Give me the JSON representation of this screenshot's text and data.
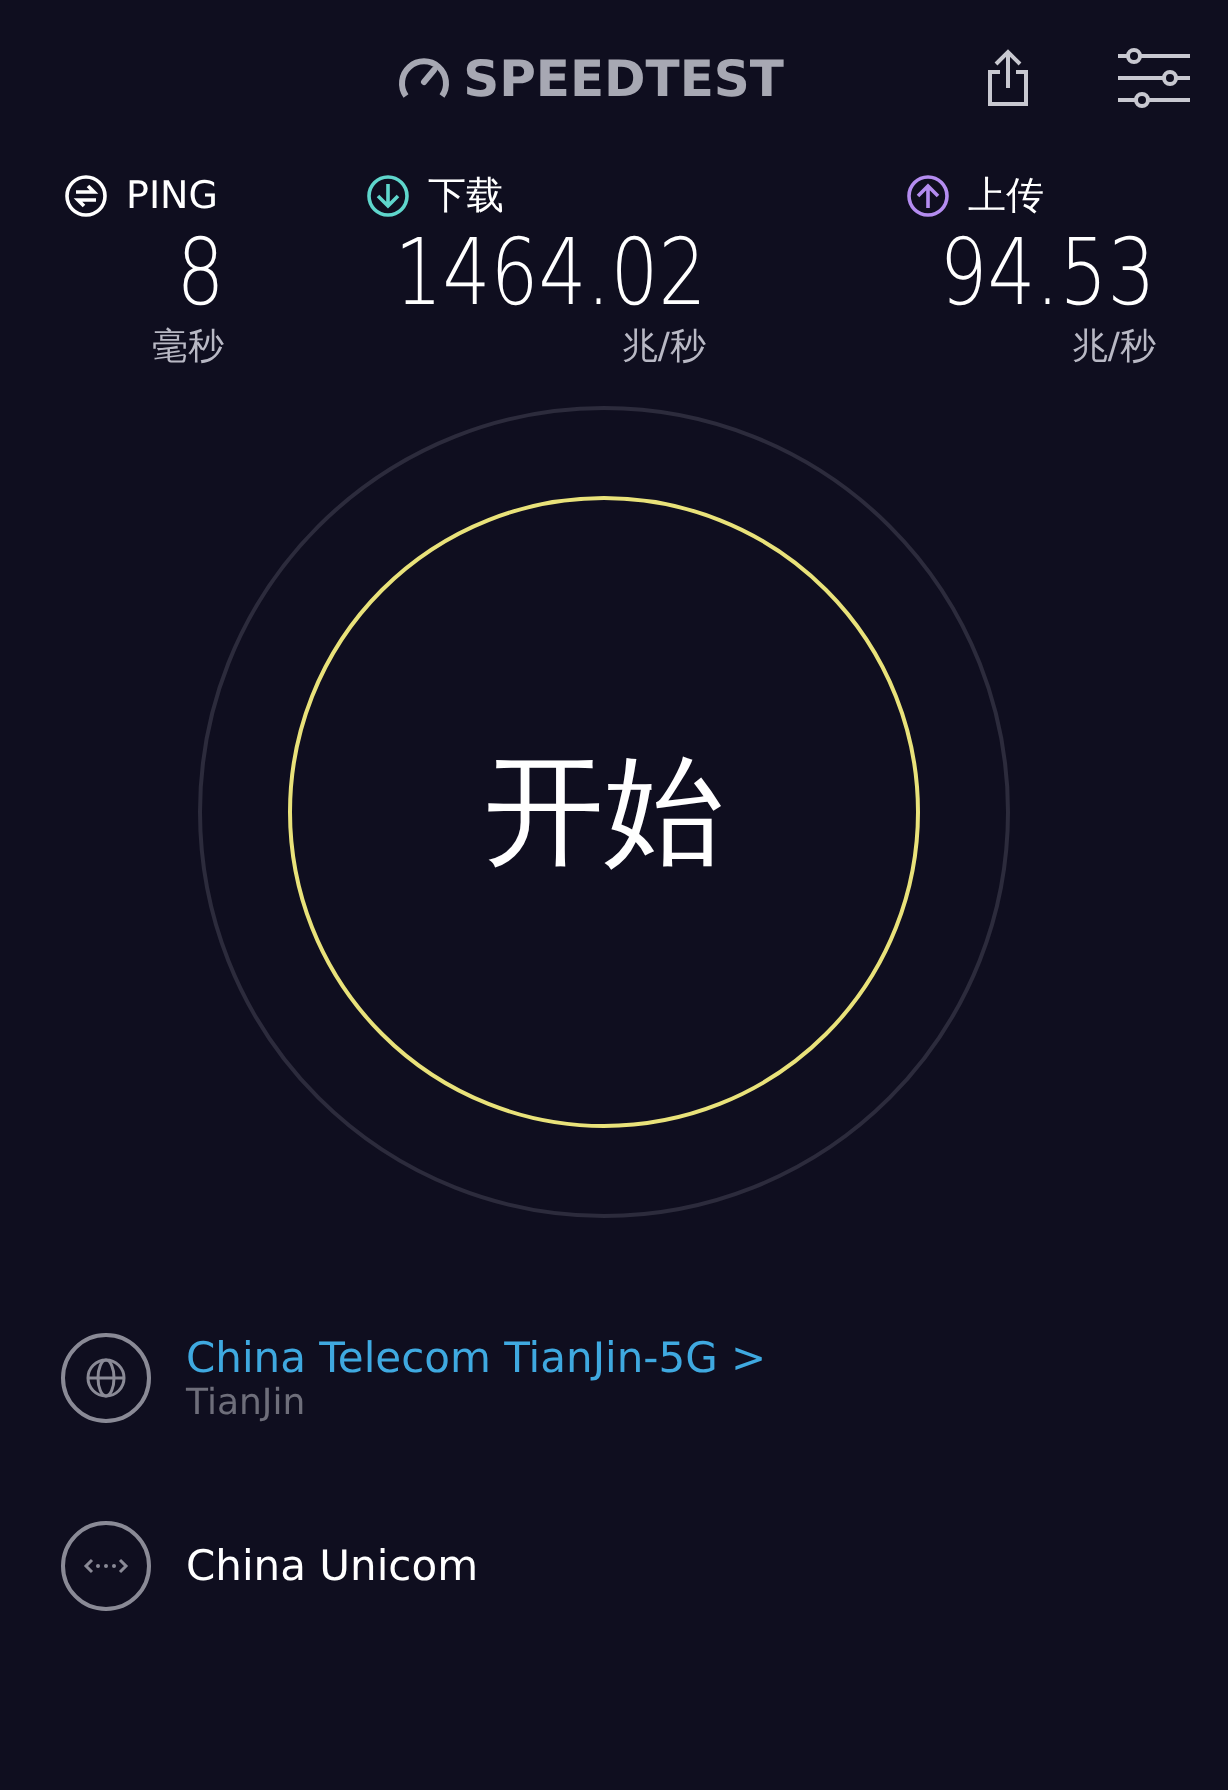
{
  "header": {
    "logo": "SPEEDTEST"
  },
  "metrics": [
    {
      "kind": "ping",
      "label": "PING",
      "value": "8",
      "unit": "毫秒",
      "color": "#ffffff"
    },
    {
      "kind": "download",
      "label": "下载",
      "value": "1464.02",
      "unit": "兆/秒",
      "color": "#5fd6cc"
    },
    {
      "kind": "upload",
      "label": "上传",
      "value": "94.53",
      "unit": "兆/秒",
      "color": "#b48cf0"
    }
  ],
  "start_button": {
    "label": "开始"
  },
  "servers": [
    {
      "kind": "server",
      "name": "China Telecom TianJin-5G",
      "chevron": ">",
      "location": "TianJin"
    },
    {
      "kind": "provider",
      "name": "China Unicom"
    }
  ]
}
